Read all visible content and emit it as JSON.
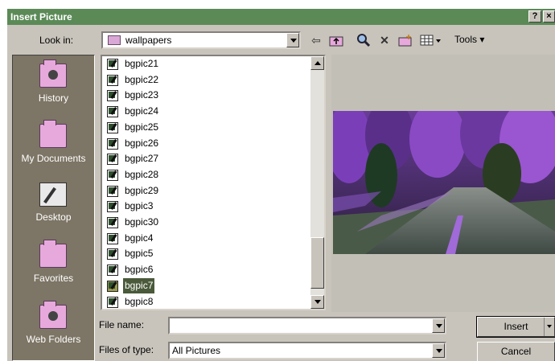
{
  "window": {
    "title": "Insert Picture",
    "help_label": "?",
    "close_label": "×"
  },
  "toolbar": {
    "look_in_label": "Look in:",
    "look_in_value": "wallpapers",
    "back_icon": "back-arrow-icon",
    "up_icon": "up-one-level-icon",
    "tools_label": "Tools ▾"
  },
  "places": [
    {
      "label": "History"
    },
    {
      "label": "My Documents"
    },
    {
      "label": "Desktop"
    },
    {
      "label": "Favorites"
    },
    {
      "label": "Web Folders"
    }
  ],
  "files": [
    "bgpic21",
    "bgpic22",
    "bgpic23",
    "bgpic24",
    "bgpic25",
    "bgpic26",
    "bgpic27",
    "bgpic28",
    "bgpic29",
    "bgpic3",
    "bgpic30",
    "bgpic4",
    "bgpic5",
    "bgpic6",
    "bgpic7",
    "bgpic8"
  ],
  "selected_file": "bgpic7",
  "file_name": {
    "label": "File name:",
    "value": ""
  },
  "file_type": {
    "label": "Files of type:",
    "value": "All Pictures"
  },
  "buttons": {
    "insert_label": "Insert",
    "cancel_label": "Cancel"
  },
  "colors": {
    "title_bar": "#5b8a57",
    "dialog_bg": "#c8c4bc",
    "places_bar": "#7d7565",
    "folder": "#e7a9dc"
  }
}
